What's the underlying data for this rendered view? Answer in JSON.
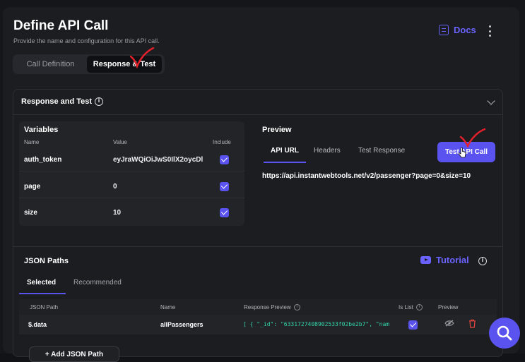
{
  "page": {
    "title": "Define API Call",
    "subtitle": "Provide the name and configuration for this API call."
  },
  "header": {
    "docs_label": "Docs"
  },
  "mode_tabs": [
    {
      "label": "Call Definition",
      "active": false
    },
    {
      "label": "Response & Test",
      "active": true
    }
  ],
  "section": {
    "title": "Response and Test"
  },
  "variables": {
    "title": "Variables",
    "columns": {
      "name": "Name",
      "value": "Value",
      "include": "Include"
    },
    "rows": [
      {
        "name": "auth_token",
        "value": "eyJraWQiOiJwS0IlX2oycDl",
        "include": true
      },
      {
        "name": "page",
        "value": "0",
        "include": true
      },
      {
        "name": "size",
        "value": "10",
        "include": true
      }
    ]
  },
  "preview": {
    "title": "Preview",
    "tabs": [
      {
        "label": "API URL",
        "active": true
      },
      {
        "label": "Headers",
        "active": false
      },
      {
        "label": "Test Response",
        "active": false
      }
    ],
    "test_button": "Test API Call",
    "url": "https://api.instantwebtools.net/v2/passenger?page=0&size=10"
  },
  "json_paths": {
    "title": "JSON Paths",
    "tutorial_label": "Tutorial",
    "tabs": [
      {
        "label": "Selected",
        "active": true
      },
      {
        "label": "Recommended",
        "active": false
      }
    ],
    "columns": {
      "path": "JSON Path",
      "name": "Name",
      "response_preview": "Response Preview",
      "is_list": "Is List",
      "preview": "Preview"
    },
    "rows": [
      {
        "path": "$.data",
        "name": "allPassengers",
        "response_preview": "[ { \"_id\": \"6331727408902533f02be2b7\", \"nam...",
        "is_list": true
      }
    ],
    "add_button": "+ Add JSON Path"
  },
  "colors": {
    "accent": "#5b53f0",
    "accent_text": "#6b63ff",
    "annotation": "#e5202b",
    "preview_text": "#34d2a8"
  },
  "icons": [
    "docs-icon",
    "more-vertical-icon",
    "info-icon",
    "chevron-down-icon",
    "checkbox-checked-icon",
    "youtube-play-icon",
    "eye-off-icon",
    "trash-icon",
    "search-icon",
    "plus-icon"
  ]
}
